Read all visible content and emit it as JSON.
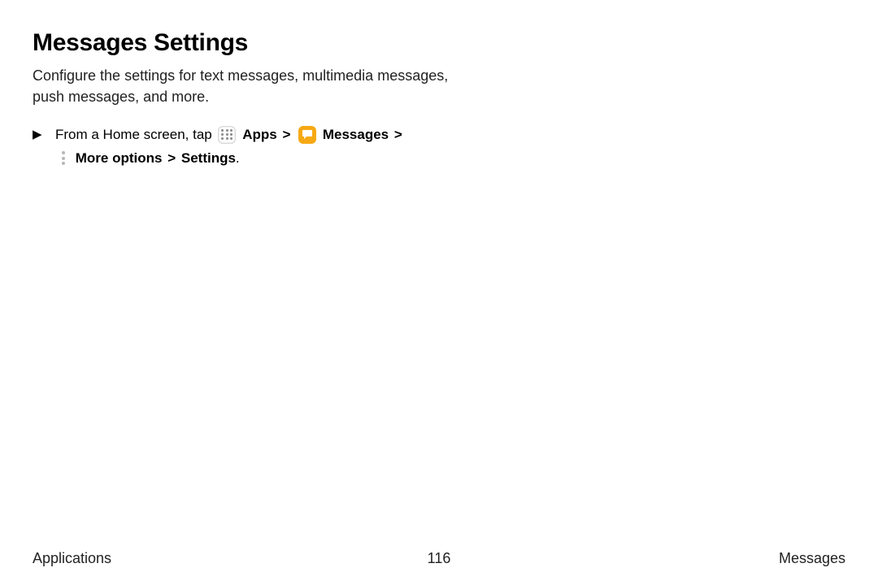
{
  "title": "Messages Settings",
  "description": "Configure the settings for text messages, multimedia messages, push messages, and more.",
  "step": {
    "marker": "▶",
    "lead": "From a Home screen, tap",
    "apps_label": "Apps",
    "messages_label": "Messages",
    "more_label": "More options",
    "settings_label": "Settings",
    "chevron": ">",
    "period": "."
  },
  "footer": {
    "left": "Applications",
    "page": "116",
    "right": "Messages"
  }
}
